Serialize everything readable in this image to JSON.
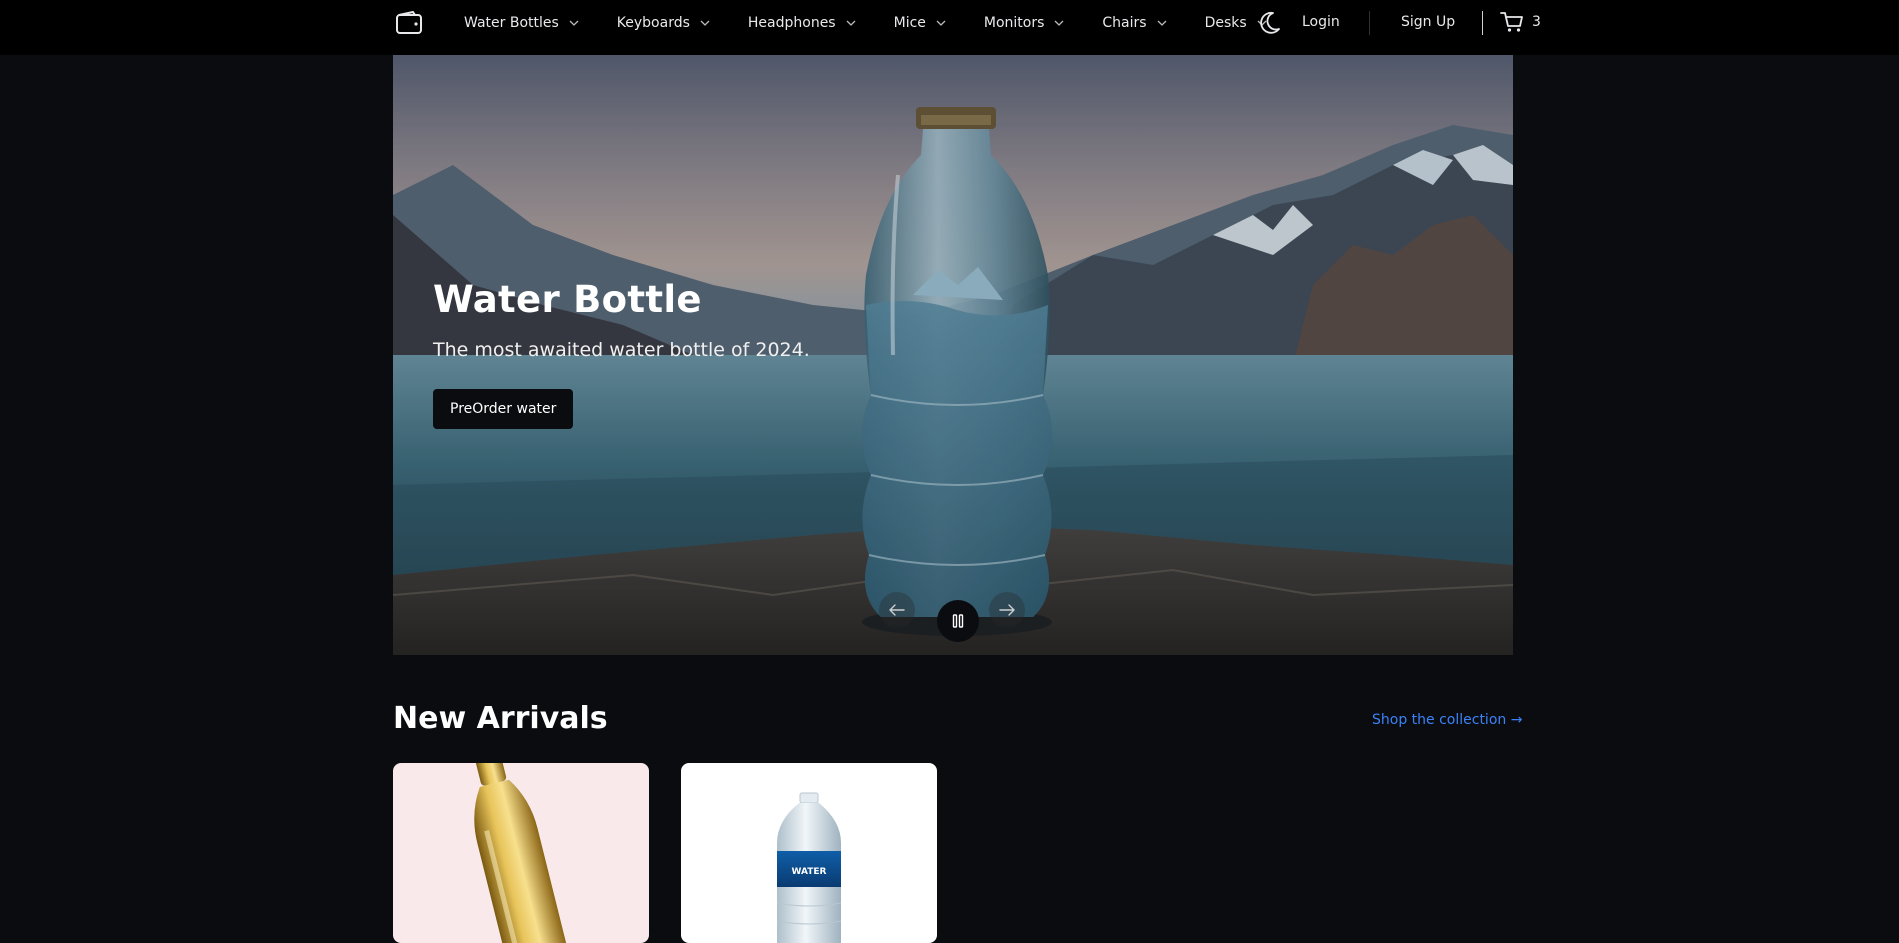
{
  "header": {
    "logo_icon": "wallet-icon",
    "nav": [
      {
        "label": "Water Bottles"
      },
      {
        "label": "Keyboards"
      },
      {
        "label": "Headphones"
      },
      {
        "label": "Mice"
      },
      {
        "label": "Monitors"
      },
      {
        "label": "Chairs"
      },
      {
        "label": "Desks"
      }
    ],
    "theme_icon": "moon-icon",
    "login_label": "Login",
    "signup_label": "Sign Up",
    "cart_icon": "cart-icon",
    "cart_count": "3"
  },
  "hero": {
    "title": "Water Bottle",
    "subtitle": "The most awaited water bottle of 2024.",
    "cta_label": "PreOrder water",
    "prev_icon": "arrow-left-icon",
    "pause_icon": "pause-icon",
    "next_icon": "arrow-right-icon"
  },
  "new_arrivals": {
    "title": "New Arrivals",
    "link_label": "Shop the collection →",
    "cards": [
      {
        "image": "gold-bottle-image"
      },
      {
        "image": "plastic-water-bottle-image",
        "bottle_label": "WATER"
      }
    ]
  },
  "colors": {
    "background": "#0b0c10",
    "header": "#000000",
    "accent_link": "#3b82f6"
  }
}
